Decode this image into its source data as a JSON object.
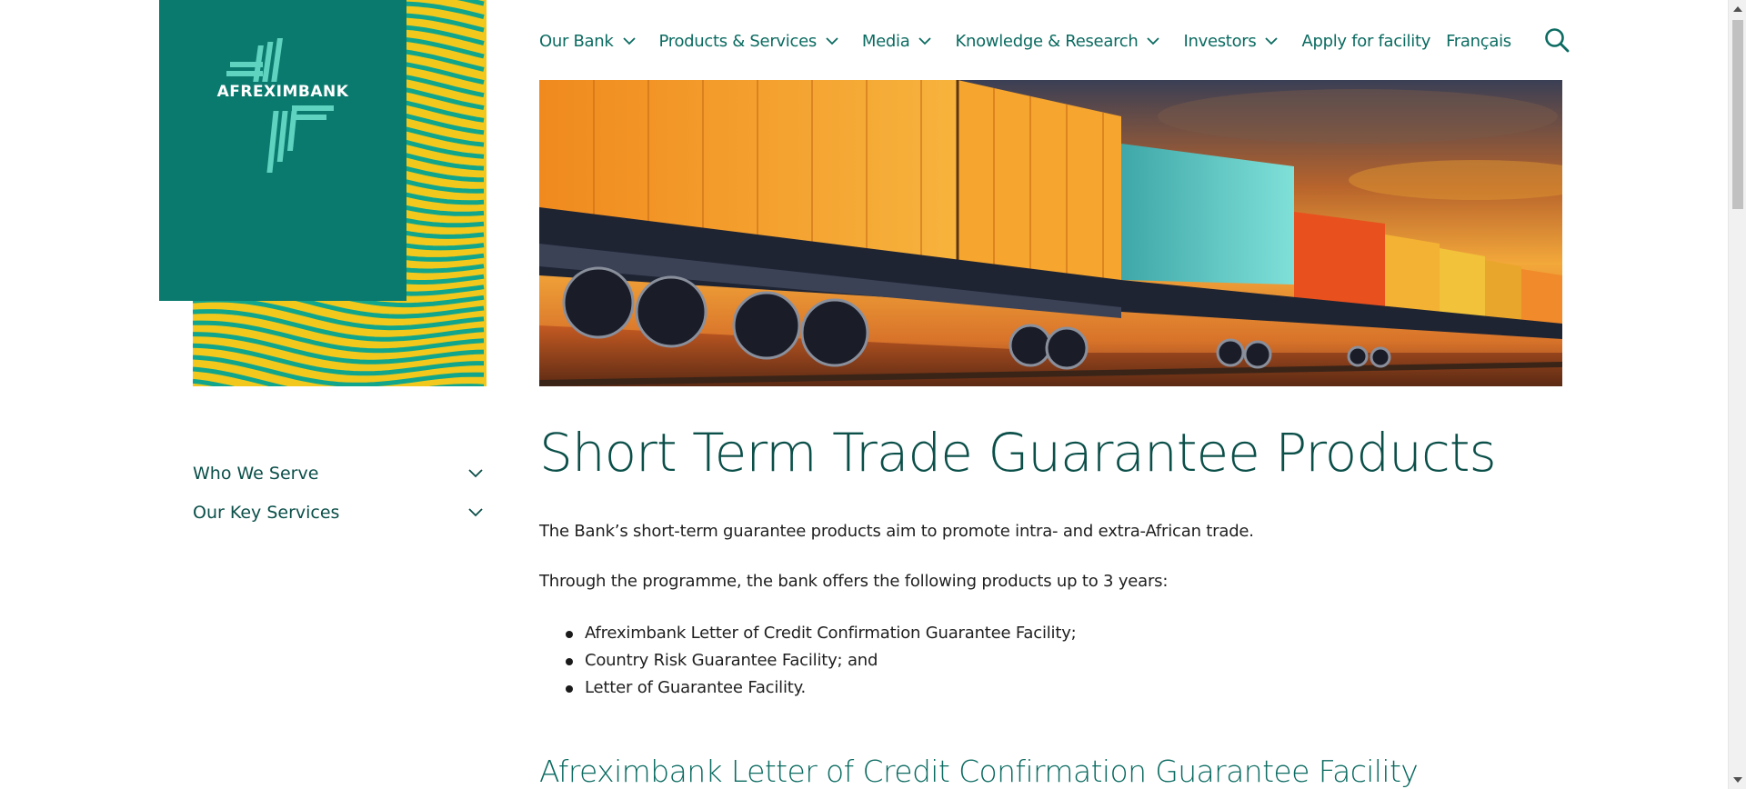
{
  "brand": {
    "logo_text": "AFREXIMBANK",
    "primary_color": "#0b7a6e",
    "accent_color": "#f2c81c"
  },
  "nav": {
    "items": [
      {
        "label": "Our Bank",
        "has_dropdown": true
      },
      {
        "label": "Products & Services",
        "has_dropdown": true
      },
      {
        "label": "Media",
        "has_dropdown": true
      },
      {
        "label": "Knowledge & Research",
        "has_dropdown": true
      },
      {
        "label": "Investors",
        "has_dropdown": true
      },
      {
        "label": "Apply for facility",
        "has_dropdown": false
      },
      {
        "label": "Français",
        "has_dropdown": false
      }
    ],
    "search_icon": "search-icon"
  },
  "hero": {
    "image_subject": "freight train with colorful shipping containers at sunset"
  },
  "sidebar": {
    "items": [
      {
        "label": "Who We Serve"
      },
      {
        "label": "Our Key Services"
      }
    ]
  },
  "content": {
    "title": "Short Term Trade Guarantee Products",
    "paragraph1": "The Bank’s short-term guarantee products aim to promote intra- and extra-African trade.",
    "paragraph2": "Through the programme, the bank offers the following products up to 3 years:",
    "bullets": [
      "Afreximbank Letter of Credit Confirmation Guarantee Facility;",
      "Country Risk Guarantee Facility; and",
      "Letter of Guarantee Facility."
    ],
    "subheading": "Afreximbank Letter of Credit Confirmation Guarantee Facility"
  }
}
